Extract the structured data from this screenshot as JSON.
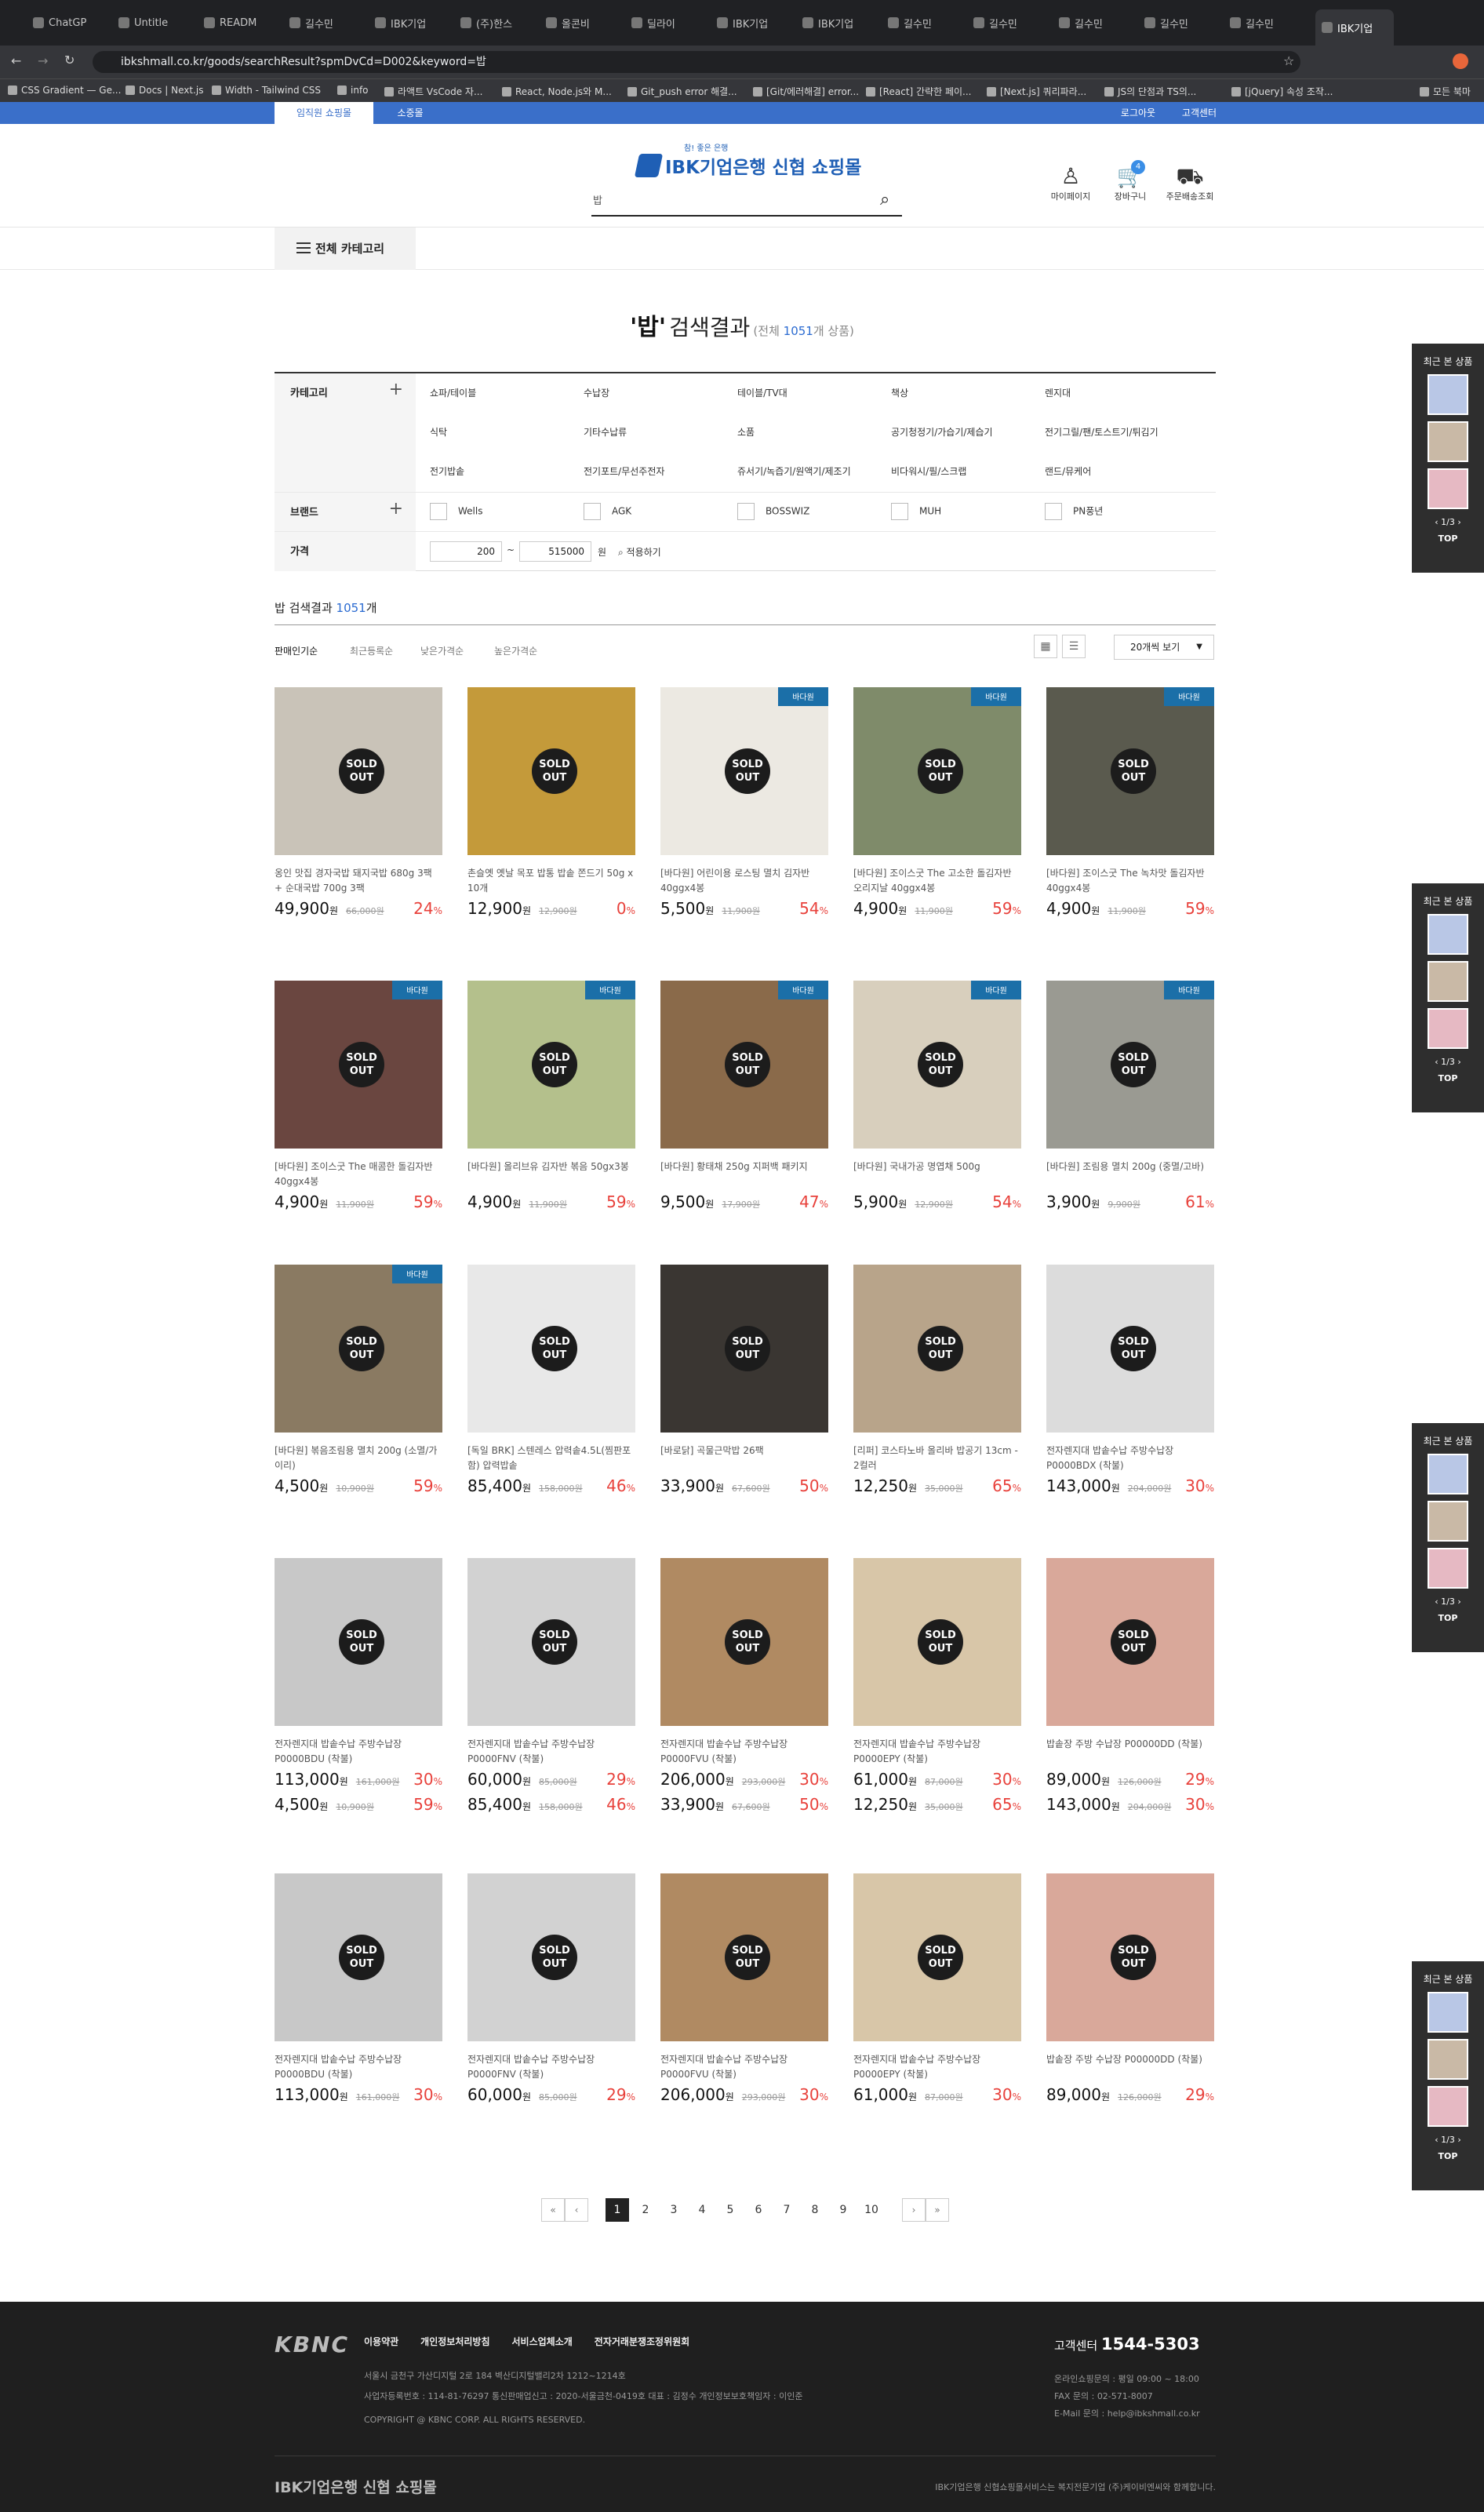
{
  "browser": {
    "tabs": [
      "ChatGP",
      "Untitle",
      "READM",
      "길수민",
      "IBK기업",
      "(주)한스",
      "올콘비",
      "딜라이",
      "IBK기업",
      "IBK기업",
      "길수민",
      "길수민",
      "길수민",
      "길수민",
      "길수민",
      "IBK기업"
    ],
    "url": "ibkshmall.co.kr/goods/searchResult?spmDvCd=D002&keyword=밥",
    "bookmarks": [
      "CSS Gradient — Ge...",
      "Docs | Next.js",
      "Width - Tailwind CSS",
      "info",
      "라액트 VsCode 자...",
      "React, Node.js와 M...",
      "Git_push error 해결...",
      "[Git/에러해결] error...",
      "[React] 간략한 페이...",
      "[Next.js] 쿼리파라...",
      "JS의 단점과 TS의...",
      "[jQuery] 속성 조작...",
      "모든 북마"
    ]
  },
  "topstrip": {
    "tab_active": "임직원 쇼핑몰",
    "tab2": "소중몰",
    "login": "로그아웃",
    "service": "고객센터"
  },
  "header": {
    "logo_sub": "참! 좋은 은행",
    "logo_text": "IBK기업은행 신협 쇼핑몰",
    "search_value": "밥",
    "icons": {
      "mypage": "마이페이지",
      "cart": "장바구니",
      "cart_count": "4",
      "delivery": "주문배송조회"
    }
  },
  "catbar": {
    "all": "전체 카테고리"
  },
  "headline": {
    "keyword": "'밥'",
    "result": "검색결과",
    "total_prefix": "(전체 ",
    "total": "1051",
    "total_suffix": "개 상품)"
  },
  "filters": {
    "category_label": "카테고리",
    "categories": [
      "쇼파/테이블",
      "수납장",
      "테이블/TV대",
      "책상",
      "렌지대",
      "식탁",
      "기타수납류",
      "소품",
      "공기청정기/가습기/제습기",
      "전기그릴/팬/토스트기/튀김기",
      "전기밥솥",
      "전기포트/무선주전자",
      "쥬서기/녹즙기/원액기/제조기",
      "비다워시/필/스크랩",
      "랜드/뮤케어"
    ],
    "brand_label": "브랜드",
    "brands": [
      "Wells",
      "AGK",
      "BOSSWIZ",
      "MUH",
      "PN풍년"
    ],
    "price_label": "가격",
    "price_min": "200",
    "price_max": "515000",
    "price_unit": "원",
    "apply": "적용하기"
  },
  "subhead": {
    "text": "밥 검색결과 ",
    "count": "1051",
    "unit": "개"
  },
  "sort": {
    "options": [
      "판매인기순",
      "최근등록순",
      "낮은가격순",
      "높은가격순"
    ],
    "view": "20개씩 보기"
  },
  "sold_out": "SOLD OUT",
  "won": "원",
  "pct_sign": "%",
  "products": [
    {
      "title": "옹인 맛집 경자국밥 돼지국밥 680g 3팩 + 순대국밥 700g 3팩",
      "price": "49,900",
      "orig": "66,000원",
      "pct": "24",
      "color": "#c9c3b8"
    },
    {
      "title": "촌슬옛 옛날 목포 밥통 밥솥 쫀드기 50g x 10개",
      "price": "12,900",
      "orig": "12,900원",
      "pct": "0",
      "color": "#c49a3a"
    },
    {
      "title": "[바다원] 어린이용 로스팅 멸치 김자반 40ggx4봉",
      "price": "5,500",
      "orig": "11,900원",
      "pct": "54",
      "color": "#ece9e2",
      "brand": "바다원"
    },
    {
      "title": "[바다원] 조이스굿 The 고소한 돌김자반 오리지날 40ggx4봉",
      "price": "4,900",
      "orig": "11,900원",
      "pct": "59",
      "color": "#7f8b6a",
      "brand": "바다원"
    },
    {
      "title": "[바다원] 조이스굿 The 녹차맛 돌김자반 40ggx4봉",
      "price": "4,900",
      "orig": "11,900원",
      "pct": "59",
      "color": "#5a5a4e",
      "brand": "바다원"
    },
    {
      "title": "[바다원] 조이스굿 The 매콤한 돌김자반 40ggx4봉",
      "price": "4,900",
      "orig": "11,900원",
      "pct": "59",
      "color": "#6a4640",
      "brand": "바다원"
    },
    {
      "title": "[바다원] 올리브유 김자반 볶음 50gx3봉",
      "price": "4,900",
      "orig": "11,900원",
      "pct": "59",
      "color": "#b4c08c",
      "brand": "바다원"
    },
    {
      "title": "[바다원] 황태채 250g 지퍼백 패키지",
      "price": "9,500",
      "orig": "17,900원",
      "pct": "47",
      "color": "#8a6a4a",
      "brand": "바다원"
    },
    {
      "title": "[바다원] 국내가공 명엽채 500g",
      "price": "5,900",
      "orig": "12,900원",
      "pct": "54",
      "color": "#d8cfbd",
      "brand": "바다원"
    },
    {
      "title": "[바다원] 조림용 멸치 200g (중멸/고바)",
      "price": "3,900",
      "orig": "9,900원",
      "pct": "61",
      "color": "#9a9a92",
      "brand": "바다원"
    },
    {
      "title": "[바다원] 볶음조림용 멸치 200g (소멸/가이리)",
      "price": "4,500",
      "orig": "10,900원",
      "pct": "59",
      "color": "#8a7a62",
      "brand": "바다원"
    },
    {
      "title": "[독일 BRK] 스텐레스 압력솥4.5L(찜판포함) 압력밥솥",
      "price": "85,400",
      "orig": "158,000원",
      "pct": "46",
      "color": "#e8e8e8"
    },
    {
      "title": "[바로닭] 곡물근막밥 26팩",
      "price": "33,900",
      "orig": "67,600원",
      "pct": "50",
      "color": "#3a3632"
    },
    {
      "title": "[리퍼] 코스타노바 올리바 밥공기 13cm - 2컬러",
      "price": "12,250",
      "orig": "35,000원",
      "pct": "65",
      "color": "#b8a48a"
    },
    {
      "title": "전자렌지대 밥솥수납 주방수납장 P0000BDX (착불)",
      "price": "143,000",
      "orig": "204,000원",
      "pct": "30",
      "color": "#dcdcdc"
    },
    {
      "title": "전자렌지대 밥솥수납 주방수납장 P0000BDU (착불)",
      "price": "113,000",
      "orig": "161,000원",
      "pct": "30",
      "price2": "4,500",
      "orig2": "10,900원",
      "pct2": "59",
      "color": "#c8c8c8"
    },
    {
      "title": "전자렌지대 밥솥수납 주방수납장 P0000FNV (착불)",
      "price": "60,000",
      "orig": "85,000원",
      "pct": "29",
      "price2": "85,400",
      "orig2": "158,000원",
      "pct2": "46",
      "color": "#d2d2d2"
    },
    {
      "title": "전자렌지대 밥솥수납 주방수납장 P0000FVU (착불)",
      "price": "206,000",
      "orig": "293,000원",
      "pct": "30",
      "price2": "33,900",
      "orig2": "67,600원",
      "pct2": "50",
      "color": "#b08a62"
    },
    {
      "title": "전자렌지대 밥솥수납 주방수납장 P0000EPY (착불)",
      "price": "61,000",
      "orig": "87,000원",
      "pct": "30",
      "price2": "12,250",
      "orig2": "35,000원",
      "pct2": "65",
      "color": "#d8c6a8"
    },
    {
      "title": "밥솥장 주방 수납장 P00000DD (착불)",
      "price": "89,000",
      "orig": "126,000원",
      "pct": "29",
      "price2": "143,000",
      "orig2": "204,000원",
      "pct2": "30",
      "color": "#d9a89a"
    },
    {
      "title": "전자렌지대 밥솥수납 주방수납장 P0000BDU (착불)",
      "price": "113,000",
      "orig": "161,000원",
      "pct": "30",
      "color": "#c8c8c8"
    },
    {
      "title": "전자렌지대 밥솥수납 주방수납장 P0000FNV (착불)",
      "price": "60,000",
      "orig": "85,000원",
      "pct": "29",
      "color": "#d2d2d2"
    },
    {
      "title": "전자렌지대 밥솥수납 주방수납장 P0000FVU (착불)",
      "price": "206,000",
      "orig": "293,000원",
      "pct": "30",
      "color": "#b08a62"
    },
    {
      "title": "전자렌지대 밥솥수납 주방수납장 P0000EPY (착불)",
      "price": "61,000",
      "orig": "87,000원",
      "pct": "30",
      "color": "#d8c6a8"
    },
    {
      "title": "밥솥장 주방 수납장 P00000DD (착불)",
      "price": "89,000",
      "orig": "126,000원",
      "pct": "29",
      "color": "#d9a89a"
    }
  ],
  "recent": {
    "title": "최근 본 상품",
    "page": "1/3",
    "top": "TOP"
  },
  "pagination": {
    "pages": [
      "1",
      "2",
      "3",
      "4",
      "5",
      "6",
      "7",
      "8",
      "9",
      "10"
    ],
    "current": "1"
  },
  "footer": {
    "logo": "KBNC",
    "links": [
      "이용약관",
      "개인정보처리방침",
      "서비스업체소개",
      "전자거래분쟁조정위원회"
    ],
    "address": "서울시 금천구 가산디지털 2로 184 벽산디지털밸리2차 1212~1214호",
    "biz": "사업자등록번호 : 114-81-76297 통신판매업신고 : 2020-서울금천-0419호 대표 : 김정수 개인정보보호책임자 : 이인준",
    "copyright": "COPYRIGHT @ KBNC CORP. ALL RIGHTS RESERVED.",
    "cc_label": "고객센터",
    "cc_phone": "1544-5303",
    "hours": "온라인쇼핑문의 : 평일 09:00 ~ 18:00",
    "fax": "FAX 문의 : 02-571-8007",
    "email": "E-Mail 문의 : help@ibkshmall.co.kr",
    "bottom_logo": "IBK기업은행 신협 쇼핑몰",
    "bottom_note": "IBK기업은행 신협쇼핑몰서비스는 복지전문기업 (주)케이비엔씨와 함께합니다."
  }
}
